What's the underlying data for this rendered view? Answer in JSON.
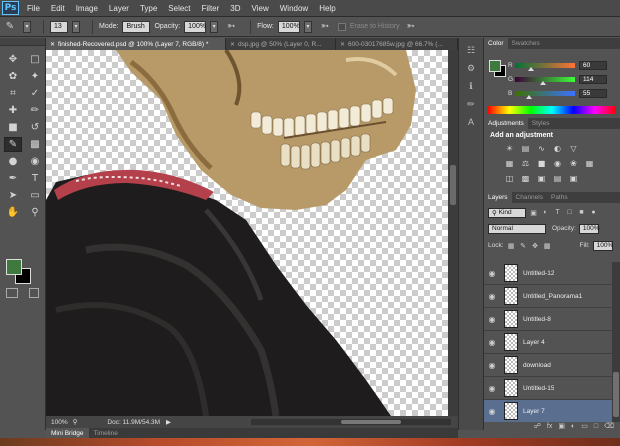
{
  "app": {
    "logo": "Ps"
  },
  "menu": [
    "File",
    "Edit",
    "Image",
    "Layer",
    "Type",
    "Select",
    "Filter",
    "3D",
    "View",
    "Window",
    "Help"
  ],
  "options": {
    "brush_size": "13",
    "mode_label": "Mode:",
    "mode_value": "Brush",
    "opacity_label": "Opacity:",
    "opacity_value": "100%",
    "flow_label": "Flow:",
    "flow_value": "100%",
    "erase_history": "Erase to History"
  },
  "doc_tabs": [
    {
      "title": "finished-Recovered.psd @ 100% (Layer 7, RGB/8) *",
      "active": true
    },
    {
      "title": "dsp.jpg @ 50% (Layer 0, R...",
      "active": false
    },
    {
      "title": "600-03017685w.jpg @ 66.7% (...",
      "active": false
    }
  ],
  "status": {
    "zoom": "100%",
    "doc": "Doc: 11.9M/54.3M"
  },
  "bottom_tabs": [
    "Mini Bridge",
    "Timeline"
  ],
  "color_panel": {
    "tabs": [
      "Color",
      "Swatches"
    ],
    "fg_color": "#3e7a3e",
    "bg_color": "#000000",
    "channels": [
      {
        "label": "R",
        "value": "60"
      },
      {
        "label": "G",
        "value": "114"
      },
      {
        "label": "B",
        "value": "55"
      }
    ]
  },
  "adjustments": {
    "tabs": [
      "Adjustments",
      "Styles"
    ],
    "title": "Add an adjustment",
    "icons": [
      "brightness-icon",
      "levels-icon",
      "curves-icon",
      "exposure-icon",
      "vibrance-icon",
      "hue-sat-icon",
      "color-balance-icon",
      "bw-icon",
      "photo-filter-icon",
      "channel-mixer-icon",
      "color-lookup-icon",
      "invert-icon",
      "posterize-icon",
      "threshold-icon",
      "gradient-map-icon",
      "selective-color-icon"
    ]
  },
  "layers": {
    "tabs": [
      "Layers",
      "Channels",
      "Paths"
    ],
    "kind": "Kind",
    "blend_mode": "Normal",
    "opacity_label": "Opacity:",
    "opacity_value": "100%",
    "lock_label": "Lock:",
    "fill_label": "Fill:",
    "fill_value": "100%",
    "items": [
      {
        "name": "Untitled-12",
        "selected": false
      },
      {
        "name": "Untitled_Panorama1",
        "selected": false
      },
      {
        "name": "Untitled-8",
        "selected": false
      },
      {
        "name": "Layer 4",
        "selected": false
      },
      {
        "name": "download",
        "selected": false
      },
      {
        "name": "Untitled-15",
        "selected": false
      },
      {
        "name": "Layer 7",
        "selected": true
      }
    ]
  }
}
